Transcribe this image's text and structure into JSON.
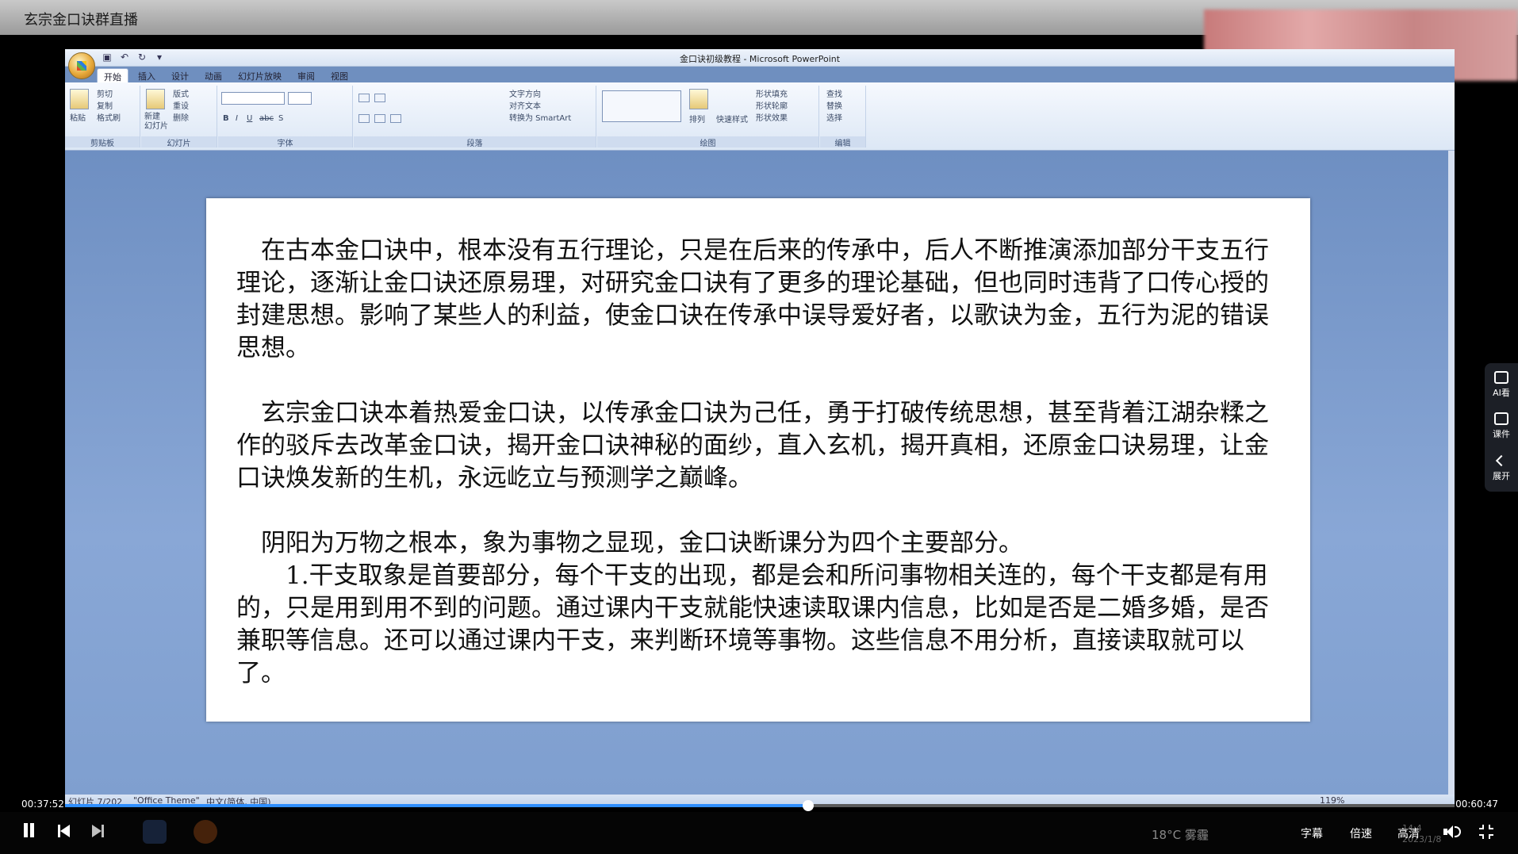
{
  "stream": {
    "title": "玄宗金口诀群直播"
  },
  "ppt": {
    "window_title": "金口诀初级教程 - Microsoft PowerPoint",
    "tabs": [
      "开始",
      "插入",
      "设计",
      "动画",
      "幻灯片放映",
      "审阅",
      "视图"
    ],
    "groups": {
      "clipboard": {
        "label": "剪贴板",
        "paste": "粘贴",
        "cut": "剪切",
        "copy": "复制",
        "format_painter": "格式刷"
      },
      "slides": {
        "label": "幻灯片",
        "new_slide": "新建\n幻灯片",
        "layout": "版式",
        "reset": "重设",
        "delete": "删除"
      },
      "font": {
        "label": "字体"
      },
      "paragraph": {
        "label": "段落",
        "text_direction": "文字方向",
        "align_text": "对齐文本",
        "smartart": "转换为 SmartArt"
      },
      "drawing": {
        "label": "绘图",
        "arrange": "排列",
        "quick_styles": "快速样式",
        "shape_fill": "形状填充",
        "shape_outline": "形状轮廓",
        "shape_effects": "形状效果"
      },
      "editing": {
        "label": "编辑",
        "find": "查找",
        "replace": "替换",
        "select": "选择"
      }
    },
    "slide": {
      "paragraphs": [
        "　在古本金口诀中，根本没有五行理论，只是在后来的传承中，后人不断推演添加部分干支五行理论，逐渐让金口诀还原易理，对研究金口诀有了更多的理论基础，但也同时违背了口传心授的封建思想。影响了某些人的利益，使金口诀在传承中误导爱好者，以歌诀为金，五行为泥的错误思想。",
        "　玄宗金口诀本着热爱金口诀，以传承金口诀为己任，勇于打破传统思想，甚至背着江湖杂糅之作的驳斥去改革金口诀，揭开金口诀神秘的面纱，直入玄机，揭开真相，还原金口诀易理，让金口诀焕发新的生机，永远屹立与预测学之巅峰。",
        "　阴阳为万物之根本，象为事物之显现，金口诀断课分为四个主要部分。",
        "　　1.干支取象是首要部分，每个干支的出现，都是会和所问事物相关连的，每个干支都是有用的，只是用到用不到的问题。通过课内干支就能快速读取课内信息，比如是否是二婚多婚，是否兼职等信息。还可以通过课内干支，来判断环境等事物。这些信息不用分析，直接读取就可以了。"
      ]
    },
    "status": {
      "slide_info": "幻灯片 7/202",
      "theme": "\"Office Theme\"",
      "language": "中文(简体, 中国)",
      "zoom": "119%"
    }
  },
  "player": {
    "current_time": "00:37:52",
    "total_time": "00:60:47",
    "progress": 0.535,
    "subtitle_label": "字幕",
    "speed_label": "倍速",
    "quality_label": "高清",
    "weather_text": "18°C 雾霾",
    "ghost_clock": [
      "14:4",
      "2023/1/8"
    ]
  },
  "side_panel": {
    "ai_label": "AI看",
    "courseware_label": "课件",
    "expand_label": "展开"
  },
  "colors": {
    "accent": "#2f8fff",
    "slide_bg": "#7f9fcf"
  }
}
